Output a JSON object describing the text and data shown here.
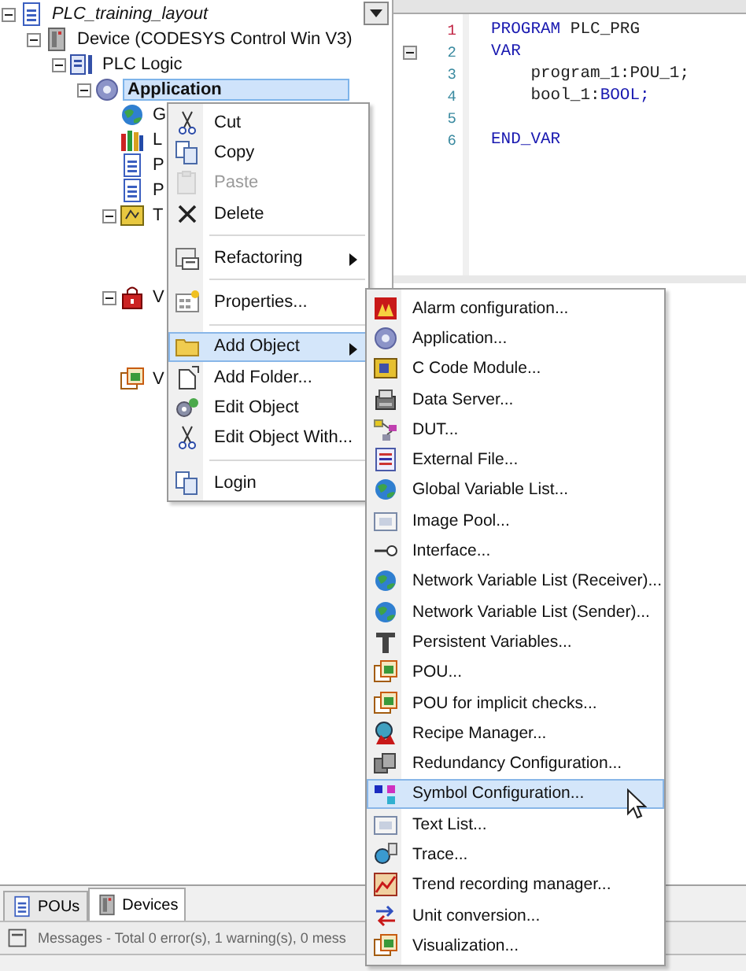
{
  "tree": {
    "label": "PLC_training_layout",
    "expanded": true,
    "selected": false,
    "children": [
      {
        "label": "Device (CODESYS Control Win V3)",
        "expanded": true,
        "selected": false,
        "children": [
          {
            "label": "PLC Logic",
            "expanded": true,
            "selected": false,
            "children": [
              {
                "label": "Application",
                "expanded": true,
                "selected": true,
                "children": [
                  {
                    "label": "G",
                    "selected": false
                  },
                  {
                    "label": "L",
                    "selected": false
                  },
                  {
                    "label": "P",
                    "selected": false
                  },
                  {
                    "label": "P",
                    "selected": false
                  },
                  {
                    "label": "T",
                    "expanded": true,
                    "selected": false
                  },
                  {
                    "label": "V",
                    "expanded": true,
                    "selected": false
                  },
                  {
                    "label": "V",
                    "selected": false
                  }
                ]
              }
            ]
          }
        ]
      }
    ]
  },
  "editor": {
    "lines": [
      {
        "number": "1",
        "current": true,
        "foldable": false,
        "tokens": [
          {
            "text": "PROGRAM",
            "kind": "keyword"
          },
          {
            "text": " PLC_PRG",
            "kind": "plain"
          }
        ]
      },
      {
        "number": "2",
        "current": false,
        "foldable": true,
        "tokens": [
          {
            "text": "VAR",
            "kind": "keyword"
          }
        ]
      },
      {
        "number": "3",
        "current": false,
        "foldable": false,
        "tokens": [
          {
            "text": "    program_1:POU_1;",
            "kind": "plain"
          }
        ]
      },
      {
        "number": "4",
        "current": false,
        "foldable": false,
        "tokens": [
          {
            "text": "    bool_1:",
            "kind": "plain"
          },
          {
            "text": "BOOL;",
            "kind": "keyword"
          }
        ]
      },
      {
        "number": "5",
        "current": false,
        "foldable": false
      },
      {
        "number": "6",
        "current": false,
        "foldable": false,
        "tokens": [
          {
            "text": "END_VAR",
            "kind": "keyword"
          }
        ]
      }
    ]
  },
  "context_menu": {
    "items": [
      {
        "kind": "item",
        "label": "Cut",
        "disabled": false,
        "submenu": false,
        "selected": false
      },
      {
        "kind": "item",
        "label": "Copy",
        "disabled": false,
        "submenu": false,
        "selected": false
      },
      {
        "kind": "item",
        "label": "Paste",
        "disabled": true,
        "submenu": false,
        "selected": false
      },
      {
        "kind": "item",
        "label": "Delete",
        "disabled": false,
        "submenu": false,
        "selected": false
      },
      {
        "kind": "separator"
      },
      {
        "kind": "item",
        "label": "Refactoring",
        "disabled": false,
        "submenu": true,
        "selected": false
      },
      {
        "kind": "separator"
      },
      {
        "kind": "item",
        "label": "Properties...",
        "disabled": false,
        "submenu": false,
        "selected": false
      },
      {
        "kind": "separator"
      },
      {
        "kind": "item",
        "label": "Add Object",
        "disabled": false,
        "submenu": true,
        "selected": true
      },
      {
        "kind": "item",
        "label": "Add Folder...",
        "disabled": false,
        "submenu": false,
        "selected": false
      },
      {
        "kind": "item",
        "label": "Edit Object",
        "disabled": false,
        "submenu": false,
        "selected": false
      },
      {
        "kind": "item",
        "label": "Edit Object With...",
        "disabled": false,
        "submenu": false,
        "selected": false
      },
      {
        "kind": "separator"
      },
      {
        "kind": "item",
        "label": "Login",
        "disabled": false,
        "submenu": false,
        "selected": false
      }
    ]
  },
  "submenu": {
    "items": [
      {
        "label": "Alarm configuration...",
        "selected": false
      },
      {
        "label": "Application...",
        "selected": false
      },
      {
        "label": "C Code Module...",
        "selected": false
      },
      {
        "label": "Data Server...",
        "selected": false
      },
      {
        "label": "DUT...",
        "selected": false
      },
      {
        "label": "External File...",
        "selected": false
      },
      {
        "label": "Global Variable List...",
        "selected": false
      },
      {
        "label": "Image Pool...",
        "selected": false
      },
      {
        "label": "Interface...",
        "selected": false
      },
      {
        "label": "Network Variable List (Receiver)...",
        "selected": false
      },
      {
        "label": "Network Variable List (Sender)...",
        "selected": false
      },
      {
        "label": "Persistent Variables...",
        "selected": false
      },
      {
        "label": "POU...",
        "selected": false
      },
      {
        "label": "POU for implicit checks...",
        "selected": false
      },
      {
        "label": "Recipe Manager...",
        "selected": false
      },
      {
        "label": "Redundancy Configuration...",
        "selected": false
      },
      {
        "label": "Symbol Configuration...",
        "selected": true
      },
      {
        "label": "Text List...",
        "selected": false
      },
      {
        "label": "Trace...",
        "selected": false
      },
      {
        "label": "Trend recording manager...",
        "selected": false
      },
      {
        "label": "Unit conversion...",
        "selected": false
      },
      {
        "label": "Visualization...",
        "selected": false
      }
    ]
  },
  "bottom_tabs": [
    {
      "label": "POUs",
      "selected": false
    },
    {
      "label": "Devices",
      "selected": true
    }
  ],
  "status_bar": {
    "text": "Messages - Total 0 error(s), 1 warning(s), 0 mess"
  }
}
